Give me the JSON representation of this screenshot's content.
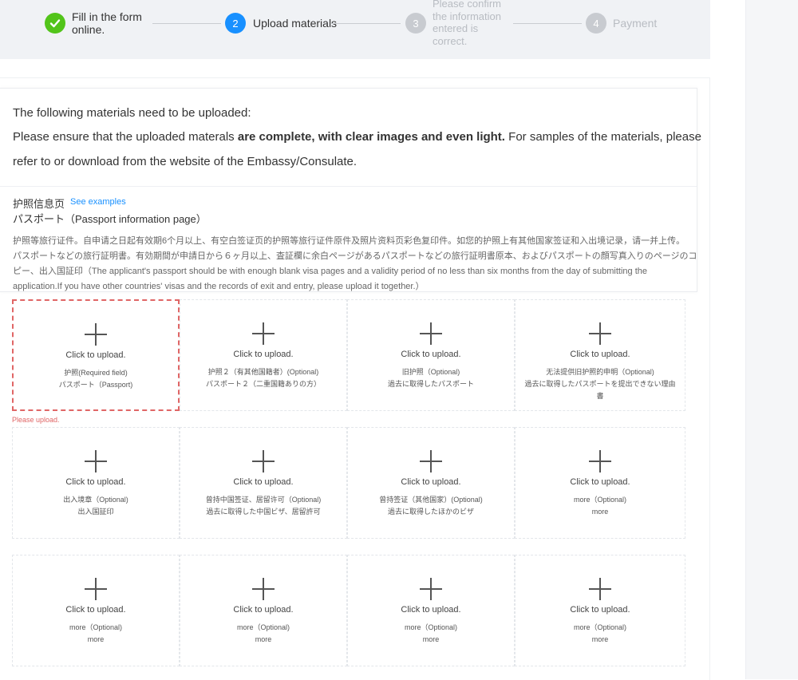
{
  "steps": [
    {
      "number": "✓",
      "label_lines": [
        "Fill in the form",
        "online."
      ],
      "state": "done"
    },
    {
      "number": "2",
      "label_lines": [
        "Upload materials"
      ],
      "state": "active"
    },
    {
      "number": "3",
      "label_lines": [
        "Please confirm",
        "the information",
        "entered is",
        "correct."
      ],
      "state": "wait"
    },
    {
      "number": "4",
      "label_lines": [
        "Payment"
      ],
      "state": "wait"
    }
  ],
  "intro": {
    "line1": "The following materials need to be uploaded:",
    "line2_pre": "Please ensure that the uploaded materals ",
    "line2_bold": "are complete, with clear images and even light.",
    "line2_post": " For samples of the materials, please",
    "line3": "refer to or download from the website of the Embassy/Consulate."
  },
  "section": {
    "title": "护照信息页",
    "see_examples": "See examples",
    "subtitle": "パスポート（Passport information page）",
    "desc_lines": [
      "护照等旅行证件。自申请之日起有效期6个月以上、有空白签证页的护照等旅行证件原件及照片资料页彩色复印件。如您的护照上有其他国家签证和入出境记录，请一并上传。",
      "パスポートなどの旅行証明書。有効期間が申請日から６ヶ月以上、査証欄に余白ページがあるパスポートなどの旅行証明書原本、およびパスポートの顔写真入りのページのコ",
      "ピー、出入国証印（The applicant's passport should be with enough blank visa pages and a validity period of no less than six months from the day of submitting the",
      "application.If you have other countries' visas and the records of exit and entry, please upload it together.）"
    ]
  },
  "upload": {
    "click_label": "Click to upload.",
    "error_message": "Please upload.",
    "items": [
      {
        "lines": [
          "护照(Required field)",
          "パスポート（Passport)"
        ],
        "error": true
      },
      {
        "lines": [
          "护照２（有其他国籍者）(Optional)",
          "パスポート２（二重国籍ありの方）"
        ],
        "error": false
      },
      {
        "lines": [
          "旧护照（Optional)",
          "過去に取得したパスポート"
        ],
        "error": false
      },
      {
        "lines": [
          "无法提供旧护照的申明（Optional)",
          "過去に取得したパスポートを提出できない理由書"
        ],
        "error": false
      },
      {
        "lines": [
          "出入境章（Optional)",
          "出入国証印"
        ],
        "error": false
      },
      {
        "lines": [
          "曾持中国签证、居留许可（Optional)",
          "過去に取得した中国ビザ、居留許可"
        ],
        "error": false
      },
      {
        "lines": [
          "曾持签证（其他国家）(Optional)",
          "過去に取得したほかのビザ"
        ],
        "error": false
      },
      {
        "lines": [
          "more（Optional)",
          "more"
        ],
        "error": false
      },
      {
        "lines": [
          "more（Optional)",
          "more"
        ],
        "error": false
      },
      {
        "lines": [
          "more（Optional)",
          "more"
        ],
        "error": false
      },
      {
        "lines": [
          "more（Optional)",
          "more"
        ],
        "error": false
      },
      {
        "lines": [
          "more（Optional)",
          "more"
        ],
        "error": false
      }
    ]
  },
  "colors": {
    "done": "#52c41a",
    "active": "#1890ff",
    "wait": "#c8cbd0",
    "error": "#e06666",
    "link": "#1890ff"
  }
}
